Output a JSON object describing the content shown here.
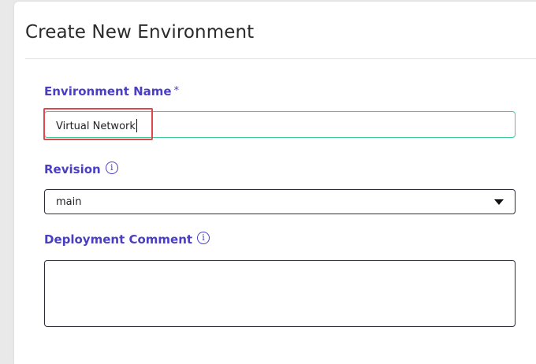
{
  "dialog": {
    "title": "Create New Environment"
  },
  "fields": {
    "environment_name": {
      "label": "Environment Name",
      "required_marker": "*",
      "value": "Virtual Network"
    },
    "revision": {
      "label": "Revision",
      "info_icon": "info-circle-icon",
      "selected": "main"
    },
    "deployment_comment": {
      "label": "Deployment Comment",
      "info_icon": "info-circle-icon",
      "value": ""
    }
  },
  "colors": {
    "label": "#4a3fc4",
    "focus_border": "#3ccf9a",
    "highlight": "#e0474c"
  }
}
